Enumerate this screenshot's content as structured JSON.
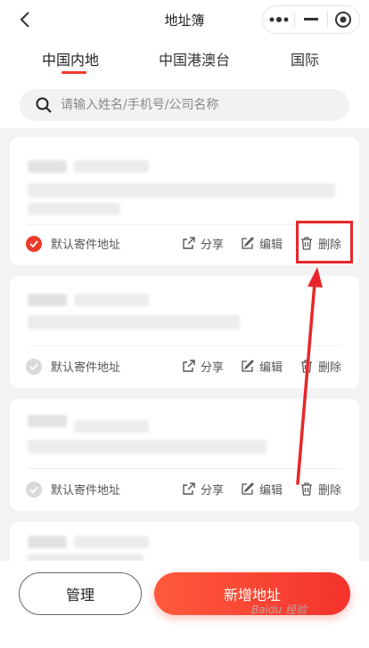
{
  "header": {
    "title": "地址簿",
    "back_icon": "chevron-left-icon",
    "capsule": {
      "more_icon": "more-dots-icon",
      "minimize_icon": "minimize-icon",
      "close_icon": "target-close-icon"
    }
  },
  "tabs": [
    {
      "label": "中国内地",
      "active": true
    },
    {
      "label": "中国港澳台",
      "active": false
    },
    {
      "label": "国际",
      "active": false
    }
  ],
  "search": {
    "placeholder": "请输入姓名/手机号/公司名称",
    "icon": "search-icon"
  },
  "cards": [
    {
      "default_label": "默认寄件地址",
      "is_default": true,
      "share": "分享",
      "edit": "编辑",
      "delete": "删除"
    },
    {
      "default_label": "默认寄件地址",
      "is_default": false,
      "share": "分享",
      "edit": "编辑",
      "delete": "删除"
    },
    {
      "default_label": "默认寄件地址",
      "is_default": false,
      "share": "分享",
      "edit": "编辑",
      "delete": "删除"
    }
  ],
  "footer": {
    "manage": "管理",
    "add": "新增地址"
  },
  "watermark": "Baidu 经验",
  "colors": {
    "accent": "#ef3b2b",
    "highlight": "#e8262a",
    "background": "#f3f3f3"
  }
}
